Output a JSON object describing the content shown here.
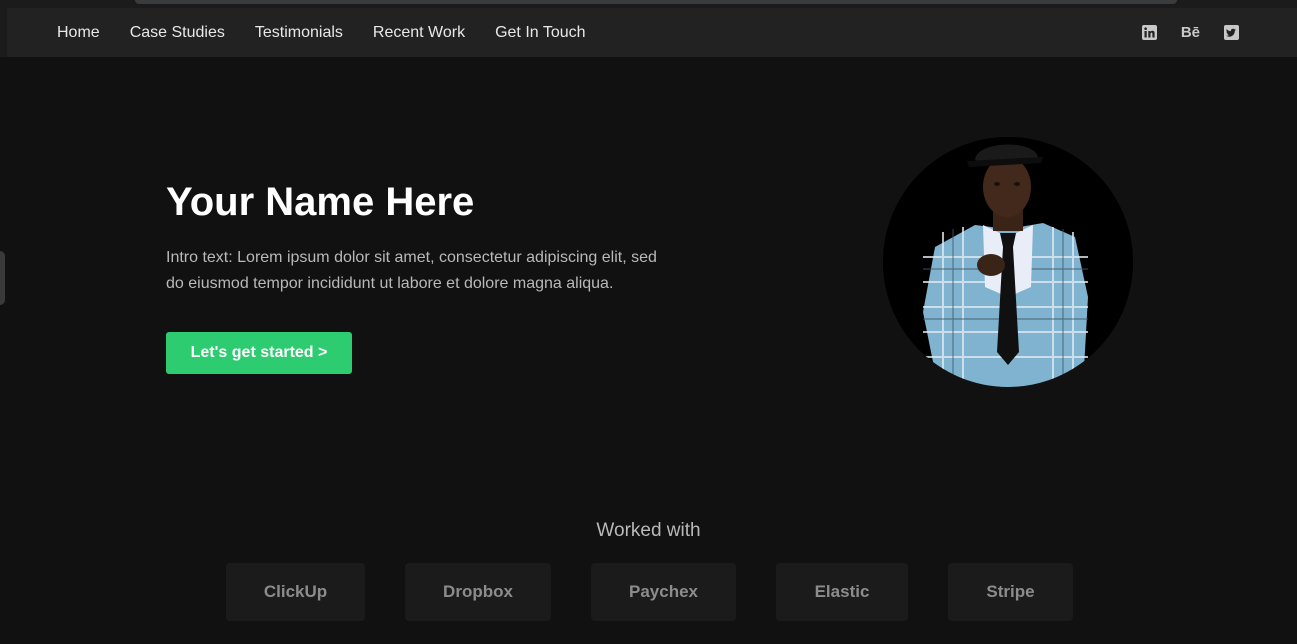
{
  "nav": {
    "links": [
      "Home",
      "Case Studies",
      "Testimonials",
      "Recent Work",
      "Get In Touch"
    ],
    "social": {
      "linkedin_icon": "linkedin-icon",
      "behance_label": "Bē",
      "twitter_icon": "twitter-icon"
    }
  },
  "hero": {
    "title": "Your Name Here",
    "intro": "Intro text: Lorem ipsum dolor sit amet, consectetur adipiscing elit, sed do eiusmod tempor incididunt ut labore et dolore magna aliqua.",
    "cta_label": "Let's get started >",
    "accent_color": "#2ecc71"
  },
  "worked_with": {
    "title": "Worked with",
    "logos": [
      "ClickUp",
      "Dropbox",
      "Paychex",
      "Elastic",
      "Stripe"
    ]
  }
}
